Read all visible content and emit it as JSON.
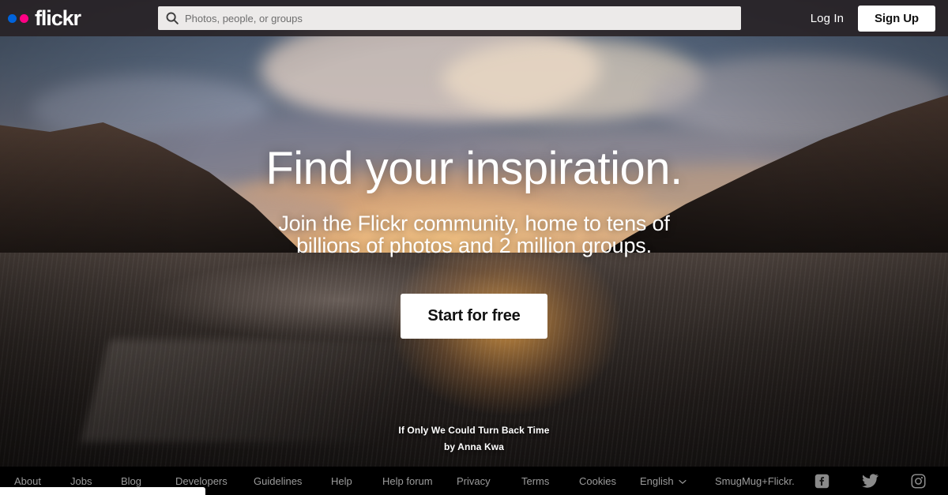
{
  "header": {
    "logo": {
      "name": "flickr",
      "dot_blue": "#0063DB",
      "dot_pink": "#FF0084"
    },
    "search": {
      "placeholder": "Photos, people, or groups",
      "value": "",
      "icon": "search-icon"
    },
    "login_label": "Log In",
    "signup_label": "Sign Up"
  },
  "hero": {
    "headline": "Find your inspiration.",
    "subheadline": "Join the Flickr community, home to tens of billions of photos and 2 million groups.",
    "cta_label": "Start for free",
    "photo_title": "If Only We Could Turn Back Time",
    "photo_credit": "by Anna Kwa"
  },
  "footer": {
    "links": [
      {
        "label": "About"
      },
      {
        "label": "Jobs"
      },
      {
        "label": "Blog"
      },
      {
        "label": "Developers"
      },
      {
        "label": "Guidelines"
      },
      {
        "label": "Help"
      },
      {
        "label": "Help forum"
      },
      {
        "label": "Privacy"
      },
      {
        "label": "Terms"
      },
      {
        "label": "Cookies"
      }
    ],
    "language": "English",
    "language_chevron": "chevron-down-icon",
    "brand": "SmugMug+Flickr.",
    "socials": [
      {
        "name": "facebook-icon"
      },
      {
        "name": "twitter-icon"
      },
      {
        "name": "instagram-icon"
      }
    ]
  },
  "colors": {
    "header_bg": "#262022",
    "footer_bg": "#000000",
    "accent_blue": "#0063DB",
    "accent_pink": "#FF0084",
    "footer_link": "#9b9b9b"
  }
}
